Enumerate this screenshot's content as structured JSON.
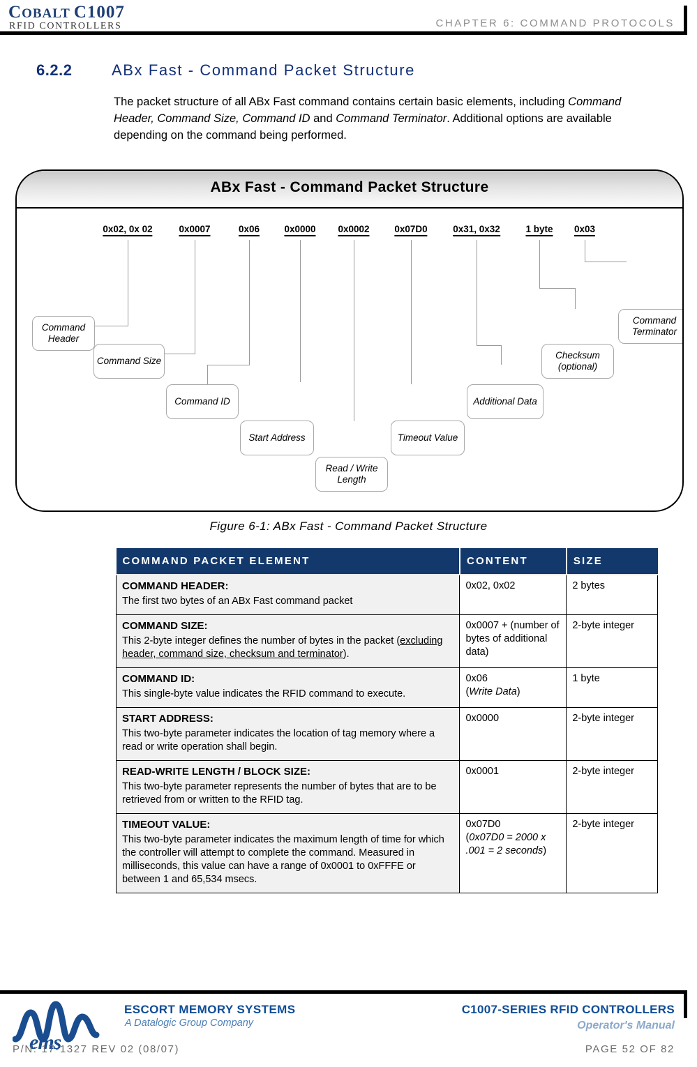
{
  "header": {
    "logo_main_big": "C",
    "logo_main": "OBALT",
    "logo_model": "C1007",
    "logo_sub": "RFID CONTROLLERS",
    "chapter": "CHAPTER 6: COMMAND PROTOCOLS"
  },
  "section": {
    "number": "6.2.2",
    "title": "ABx Fast - Command Packet Structure"
  },
  "intro": {
    "p1": "The packet structure of all ABx Fast command contains certain basic elements, including ",
    "em1": "Command Header, Command Size, Command ID",
    "p2": " and ",
    "em2": "Command Terminator",
    "p3": ". Additional options are available depending on the command being performed."
  },
  "diagram": {
    "title": "ABx Fast - Command Packet Structure",
    "hex_labels": [
      "0x02, 0x 02",
      "0x0007",
      "0x06",
      "0x0000",
      "0x0002",
      "0x07D0",
      "0x31, 0x32",
      "1 byte",
      "0x03"
    ],
    "callouts": [
      "Command Header",
      "Command Size",
      "Command ID",
      "Start Address",
      "Read / Write Length",
      "Timeout Value",
      "Additional Data",
      "Checksum (optional)",
      "Command Terminator"
    ]
  },
  "figure_caption": "Figure 6-1: ABx Fast - Command Packet Structure",
  "table": {
    "headers": [
      "COMMAND PACKET ELEMENT",
      "CONTENT",
      "SIZE"
    ],
    "rows": [
      {
        "title": "COMMAND HEADER:",
        "desc": "The first two bytes of an ABx Fast command packet",
        "content": "0x02, 0x02",
        "size": "2 bytes"
      },
      {
        "title": "COMMAND SIZE:",
        "desc_a": "This 2-byte integer defines the number of bytes in the packet (",
        "desc_u": "excluding header, command size, checksum and terminator",
        "desc_b": ").",
        "content": "0x0007 + (number of bytes of additional data)",
        "size": "2-byte integer"
      },
      {
        "title": "COMMAND ID:",
        "desc": "This single-byte value indicates the RFID command to execute.",
        "content_a": "0x06",
        "content_em": "Write Data",
        "size": "1 byte"
      },
      {
        "title": "START ADDRESS:",
        "desc": "This two-byte parameter indicates the location of tag memory where a read or write operation shall begin.",
        "content": "0x0000",
        "size": "2-byte integer"
      },
      {
        "title": "READ-WRITE LENGTH / BLOCK SIZE:",
        "desc": "This two-byte parameter represents the number of bytes that are to be retrieved from or written to the RFID tag.",
        "content": "0x0001",
        "size": "2-byte integer"
      },
      {
        "title": "TIMEOUT VALUE:",
        "desc": "This two-byte parameter indicates the maximum length of time for which the controller will attempt to complete the command. Measured in milliseconds, this value can have a range of 0x0001 to 0xFFFE or between 1 and 65,534 msecs.",
        "content_a": "0x07D0",
        "content_em": "0x07D0 = 2000 x .001 = 2 seconds",
        "size": "2-byte integer"
      }
    ]
  },
  "footer": {
    "company": "ESCORT MEMORY SYSTEMS",
    "company_sub": "A Datalogic Group Company",
    "logo_word": "ems",
    "product": "C1007-SERIES RFID CONTROLLERS",
    "product_sub": "Operator's Manual",
    "part_number": "P/N: 17-1327 REV 02 (08/07)",
    "page": "PAGE 52 OF 82"
  },
  "colors": {
    "brand_navy": "#12307a",
    "table_header": "#13386b",
    "footer_blue": "#0f4d96",
    "muted_gray": "#8d8d8d"
  }
}
